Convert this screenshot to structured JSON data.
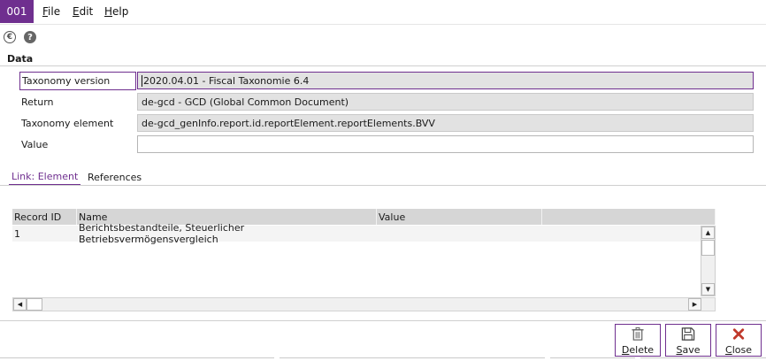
{
  "app": {
    "badge": "001"
  },
  "menu": [
    {
      "first": "F",
      "rest": "ile"
    },
    {
      "first": "E",
      "rest": "dit"
    },
    {
      "first": "H",
      "rest": "elp"
    }
  ],
  "toolbar": {
    "euro_icon": "euro-icon",
    "help_icon": "help-icon",
    "euro_glyph": "€",
    "help_glyph": "?"
  },
  "section": {
    "title": "Data"
  },
  "fields": {
    "taxonomy_version": {
      "label": "Taxonomy version",
      "value": "2020.04.01 - Fiscal Taxonomie 6.4"
    },
    "return": {
      "label": "Return",
      "value": "de-gcd - GCD (Global Common Document)"
    },
    "taxonomy_element": {
      "label": "Taxonomy element",
      "value": "de-gcd_genInfo.report.id.reportElement.reportElements.BVV"
    },
    "value": {
      "label": "Value",
      "value": ""
    }
  },
  "tabs": [
    {
      "label": "Link: Element",
      "active": true
    },
    {
      "label": "References",
      "active": false
    }
  ],
  "grid": {
    "columns": [
      "Record ID",
      "Name",
      "Value",
      ""
    ],
    "rows": [
      {
        "record_id": "1",
        "name": "Berichtsbestandteile, Steuerlicher Betriebsvermögensvergleich",
        "value": ""
      }
    ]
  },
  "actions": {
    "delete": {
      "first": "D",
      "rest": "elete"
    },
    "save": {
      "first": "S",
      "rest": "ave"
    },
    "close": {
      "first": "C",
      "rest": "lose"
    }
  },
  "colors": {
    "accent": "#6f2f8f",
    "readonly_field": "#e2e2e2",
    "close_icon": "#c0392b"
  }
}
